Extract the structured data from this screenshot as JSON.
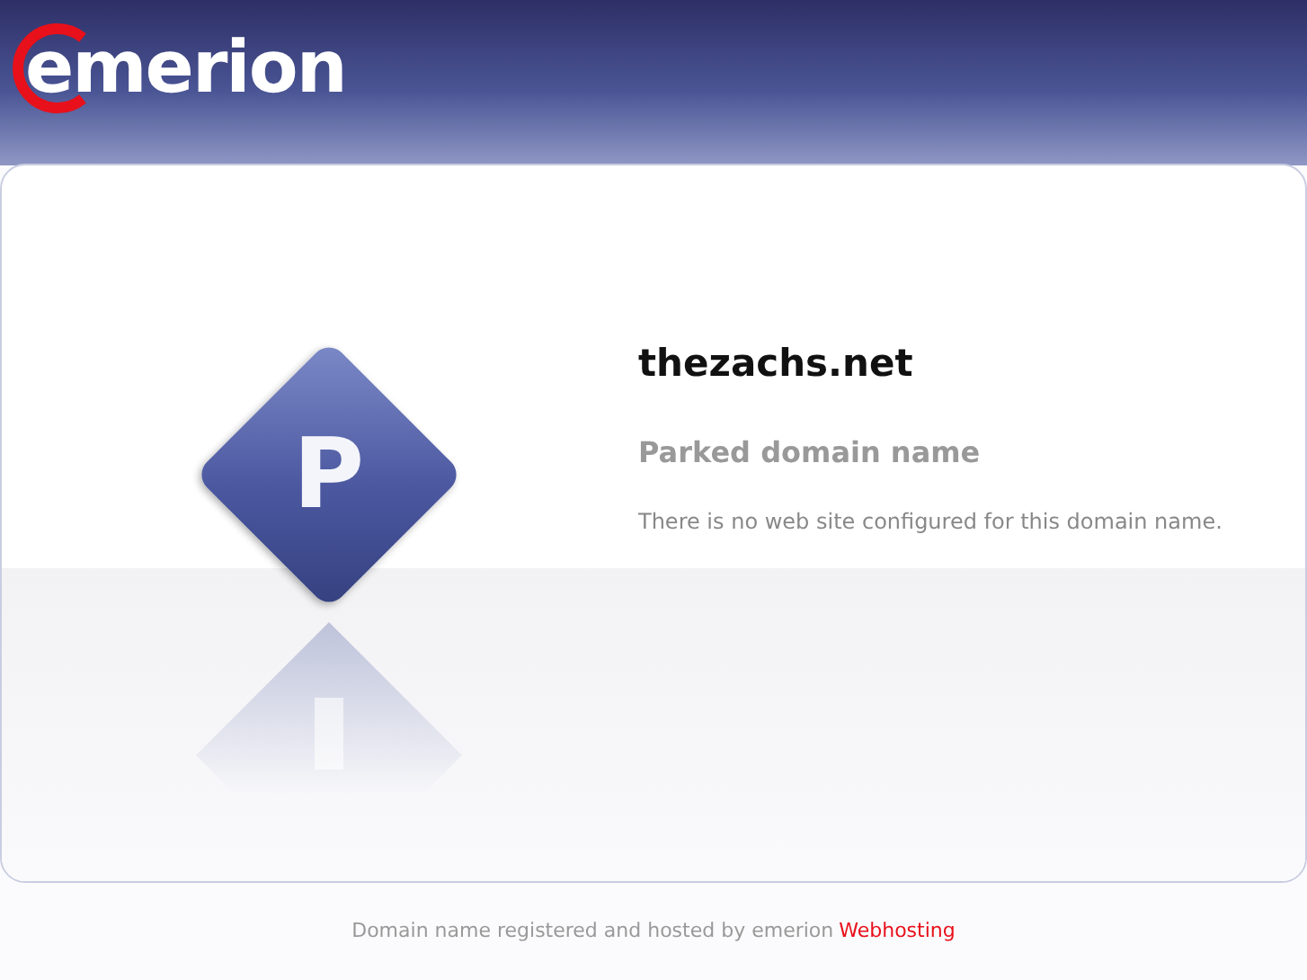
{
  "header": {
    "logo": "emerion"
  },
  "badge": {
    "letter": "P"
  },
  "content": {
    "domain": "thezachs.net",
    "heading": "Parked domain name",
    "message": "There is no web site configured for this domain name."
  },
  "footer": {
    "text": "Domain name registered and hosted by emerion",
    "link": "Webhosting"
  }
}
